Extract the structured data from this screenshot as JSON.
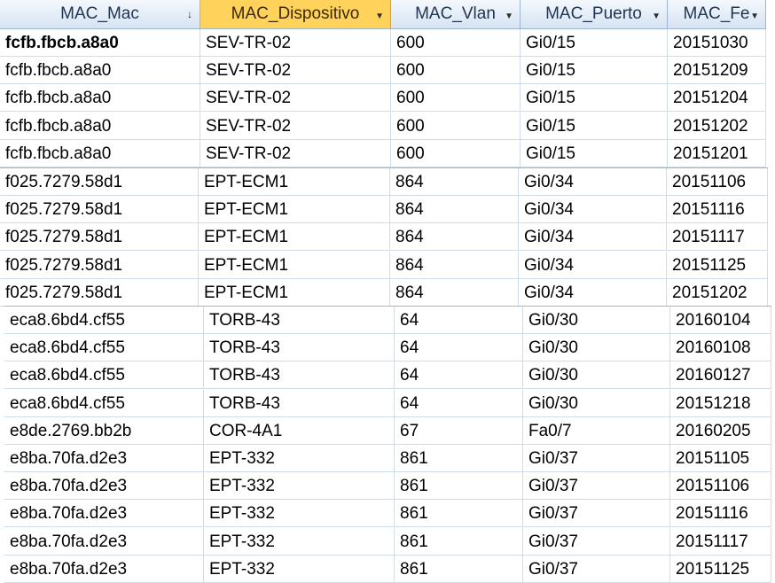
{
  "columns": [
    {
      "label": "MAC_Mac",
      "indicator": "sort-icon"
    },
    {
      "label": "MAC_Dispositivo",
      "indicator": "dropdown-arrow-icon"
    },
    {
      "label": "MAC_Vlan",
      "indicator": "dropdown-arrow-icon"
    },
    {
      "label": "MAC_Puerto",
      "indicator": "dropdown-arrow-icon"
    },
    {
      "label": "MAC_Fe",
      "indicator": "dropdown-arrow-icon"
    }
  ],
  "icons": {
    "sort": "↓",
    "dropdown": "▼"
  },
  "rows": [
    [
      "fcfb.fbcb.a8a0",
      "SEV-TR-02",
      "600",
      "Gi0/15",
      "20151030"
    ],
    [
      "fcfb.fbcb.a8a0",
      "SEV-TR-02",
      "600",
      "Gi0/15",
      "20151209"
    ],
    [
      "fcfb.fbcb.a8a0",
      "SEV-TR-02",
      "600",
      "Gi0/15",
      "20151204"
    ],
    [
      "fcfb.fbcb.a8a0",
      "SEV-TR-02",
      "600",
      "Gi0/15",
      "20151202"
    ],
    [
      "fcfb.fbcb.a8a0",
      "SEV-TR-02",
      "600",
      "Gi0/15",
      "20151201"
    ],
    [
      "f025.7279.58d1",
      "EPT-ECM1",
      "864",
      "Gi0/34",
      "20151106"
    ],
    [
      "f025.7279.58d1",
      "EPT-ECM1",
      "864",
      "Gi0/34",
      "20151116"
    ],
    [
      "f025.7279.58d1",
      "EPT-ECM1",
      "864",
      "Gi0/34",
      "20151117"
    ],
    [
      "f025.7279.58d1",
      "EPT-ECM1",
      "864",
      "Gi0/34",
      "20151125"
    ],
    [
      "f025.7279.58d1",
      "EPT-ECM1",
      "864",
      "Gi0/34",
      "20151202"
    ],
    [
      "eca8.6bd4.cf55",
      "TORB-43",
      "64",
      "Gi0/30",
      "20160104"
    ],
    [
      "eca8.6bd4.cf55",
      "TORB-43",
      "64",
      "Gi0/30",
      "20160108"
    ],
    [
      "eca8.6bd4.cf55",
      "TORB-43",
      "64",
      "Gi0/30",
      "20160127"
    ],
    [
      "eca8.6bd4.cf55",
      "TORB-43",
      "64",
      "Gi0/30",
      "20151218"
    ],
    [
      "e8de.2769.bb2b",
      "COR-4A1",
      "67",
      "Fa0/7",
      "20160205"
    ],
    [
      "e8ba.70fa.d2e3",
      "EPT-332",
      "861",
      "Gi0/37",
      "20151105"
    ],
    [
      "e8ba.70fa.d2e3",
      "EPT-332",
      "861",
      "Gi0/37",
      "20151106"
    ],
    [
      "e8ba.70fa.d2e3",
      "EPT-332",
      "861",
      "Gi0/37",
      "20151116"
    ],
    [
      "e8ba.70fa.d2e3",
      "EPT-332",
      "861",
      "Gi0/37",
      "20151117"
    ],
    [
      "e8ba.70fa.d2e3",
      "EPT-332",
      "861",
      "Gi0/37",
      "20151125"
    ]
  ],
  "colors": {
    "header_selected": "#ffd25b",
    "header": "#d6e3f3",
    "gridline": "#d0dbe8"
  }
}
